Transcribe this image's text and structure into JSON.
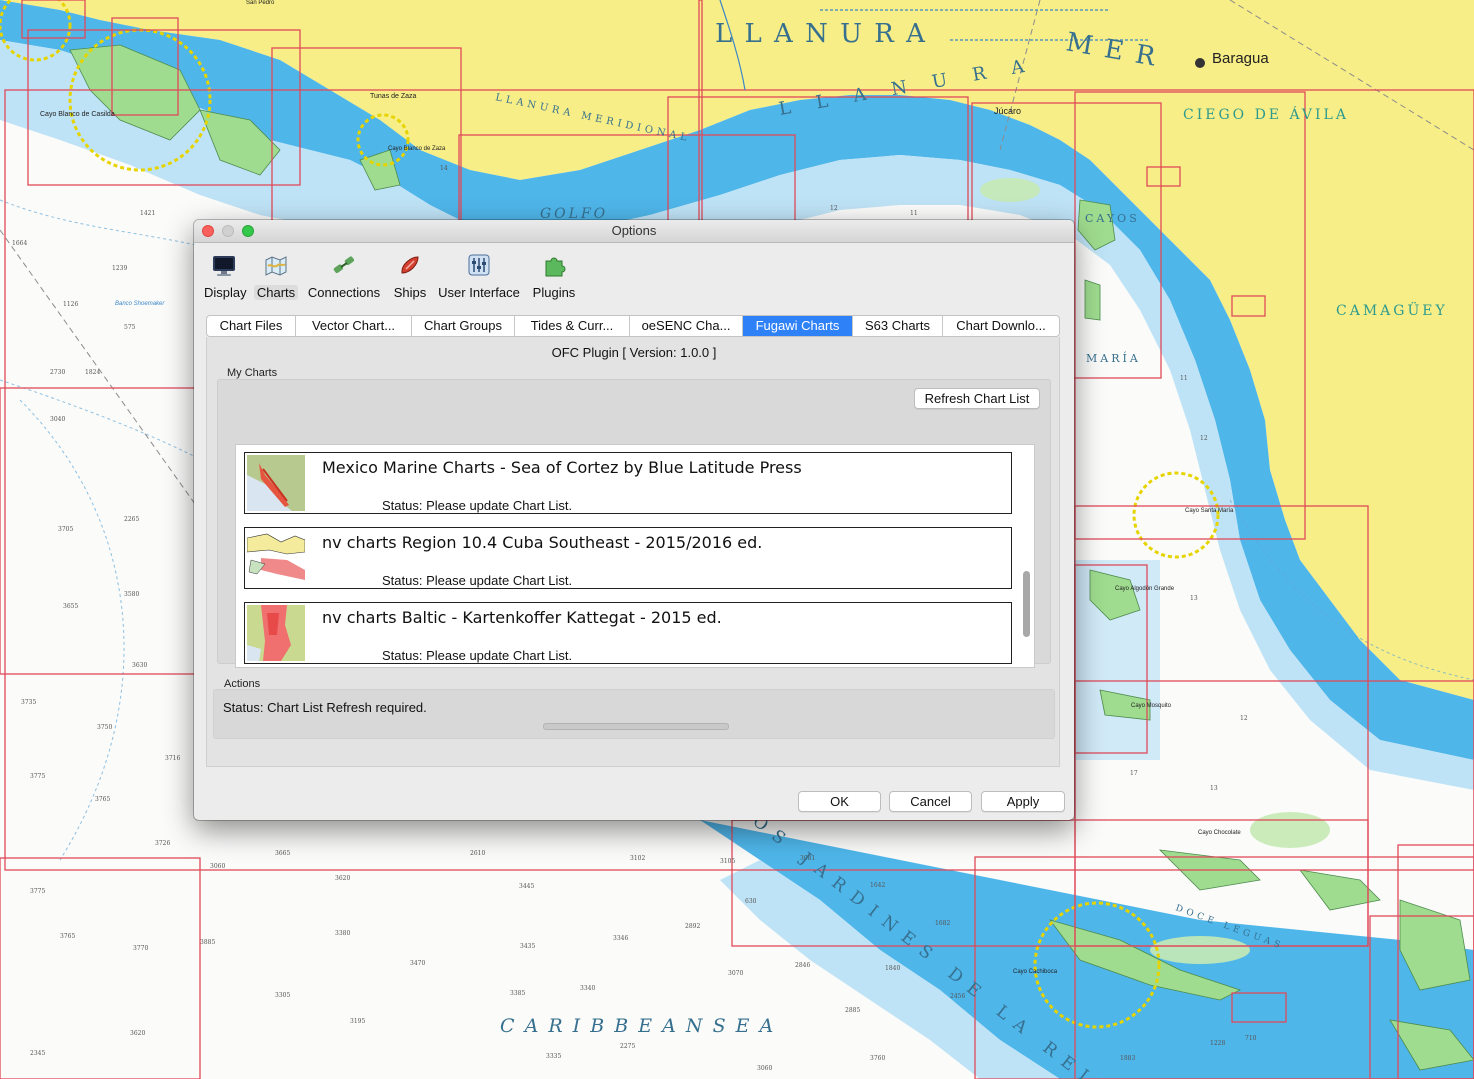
{
  "map": {
    "labels": {
      "llanura1": "L L A N U R A",
      "mer": "M E R",
      "llanura2": "L L A N U R A",
      "llanura3": "LLANURA MERIDIONAL",
      "baragua": "Baragua",
      "ciego": "CIEGO DE ÁVILA",
      "camaguey": "CAMAGÜEY",
      "golfo": "GOLFO",
      "caribbean": "C A R I B B E A N   S E A",
      "jardines": "LOS JARDINES DE LA REINA",
      "cayos_de": "CAYOS",
      "maria": "MARÍA",
      "jucaro": "Júcaro",
      "tunas": "Tunas de Zaza",
      "cayo_blanco_casilda": "Cayo Blanco de Casilda",
      "cayo_blanco_zaza": "Cayo Blanco de Zaza",
      "cayo_santa_maria": "Cayo Santa María",
      "cayo_algodon": "Cayo Algodón Grande",
      "cayo_mosquito": "Cayo Mosquito",
      "cayo_chocolate": "Cayo Chocolate",
      "cayo_cachiboca": "Cayo Cachiboca",
      "san_pedro": "San Pedro",
      "banco": "Banco Shoemaker",
      "doce_leguas": "DOCE LEGUAS"
    }
  },
  "dialog": {
    "title": "Options",
    "toolbar": [
      {
        "label": "Display",
        "icon": "display-icon"
      },
      {
        "label": "Charts",
        "icon": "charts-icon"
      },
      {
        "label": "Connections",
        "icon": "connections-icon"
      },
      {
        "label": "Ships",
        "icon": "ships-icon"
      },
      {
        "label": "User Interface",
        "icon": "user-interface-icon"
      },
      {
        "label": "Plugins",
        "icon": "plugins-icon"
      }
    ],
    "active_toolbar": "Charts",
    "tabs": [
      "Chart Files",
      "Vector Chart...",
      "Chart Groups",
      "Tides & Curr...",
      "oeSENC Cha...",
      "Fugawi Charts",
      "S63 Charts",
      "Chart Downlo..."
    ],
    "active_tab": "Fugawi Charts",
    "plugin_title": "OFC Plugin [ Version: 1.0.0 ]",
    "my_charts_label": "My Charts",
    "refresh_button": "Refresh Chart List",
    "charts": [
      {
        "name": "Mexico Marine Charts - Sea of Cortez by Blue Latitude Press",
        "status": "Status: Please update Chart List."
      },
      {
        "name": "nv charts Region 10.4 Cuba Southeast - 2015/2016 ed.",
        "status": "Status: Please update Chart List."
      },
      {
        "name": "nv charts Baltic - Kartenkoffer Kattegat - 2015 ed.",
        "status": "Status: Please update Chart List."
      }
    ],
    "actions_label": "Actions",
    "actions_status": "Status: Chart List Refresh required.",
    "buttons": {
      "ok": "OK",
      "cancel": "Cancel",
      "apply": "Apply"
    }
  }
}
